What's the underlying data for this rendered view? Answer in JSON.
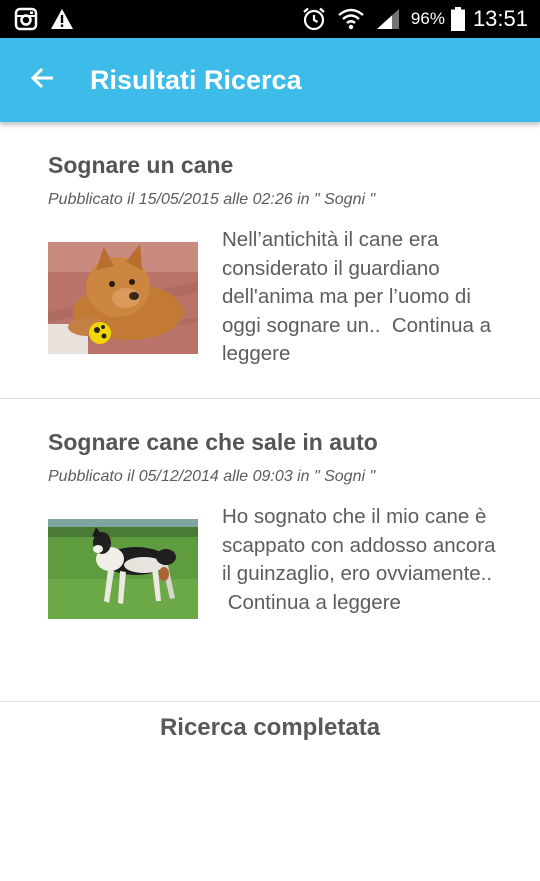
{
  "status_bar": {
    "battery_percent": "96%",
    "time": "13:51",
    "icons": [
      "instagram-icon",
      "warning-icon",
      "alarm-icon",
      "wifi-icon",
      "signal-icon",
      "battery-icon"
    ]
  },
  "app_bar": {
    "back_icon": "arrow-left-icon",
    "title": "Risultati Ricerca",
    "background": "#3dbbe9"
  },
  "results": [
    {
      "title": "Sognare un cane",
      "meta": "Pubblicato il 15/05/2015 alle 02:26 in \" Sogni \"",
      "excerpt": "Nell’antichità il cane era considerato il guardiano dell'anima ma per l’uomo di oggi sognare un..",
      "read_more": "Continua a leggere",
      "image": "dog-with-ball-photo"
    },
    {
      "title": "Sognare cane che sale in auto",
      "meta": "Pubblicato il 05/12/2014 alle 09:03 in \" Sogni \"",
      "excerpt": "Ho sognato che il mio cane è scappato con addosso ancora il guinzaglio, ero ovviamente..",
      "read_more": "Continua a leggere",
      "image": "dog-on-grass-photo"
    }
  ],
  "footer": {
    "status": "Ricerca completata"
  }
}
